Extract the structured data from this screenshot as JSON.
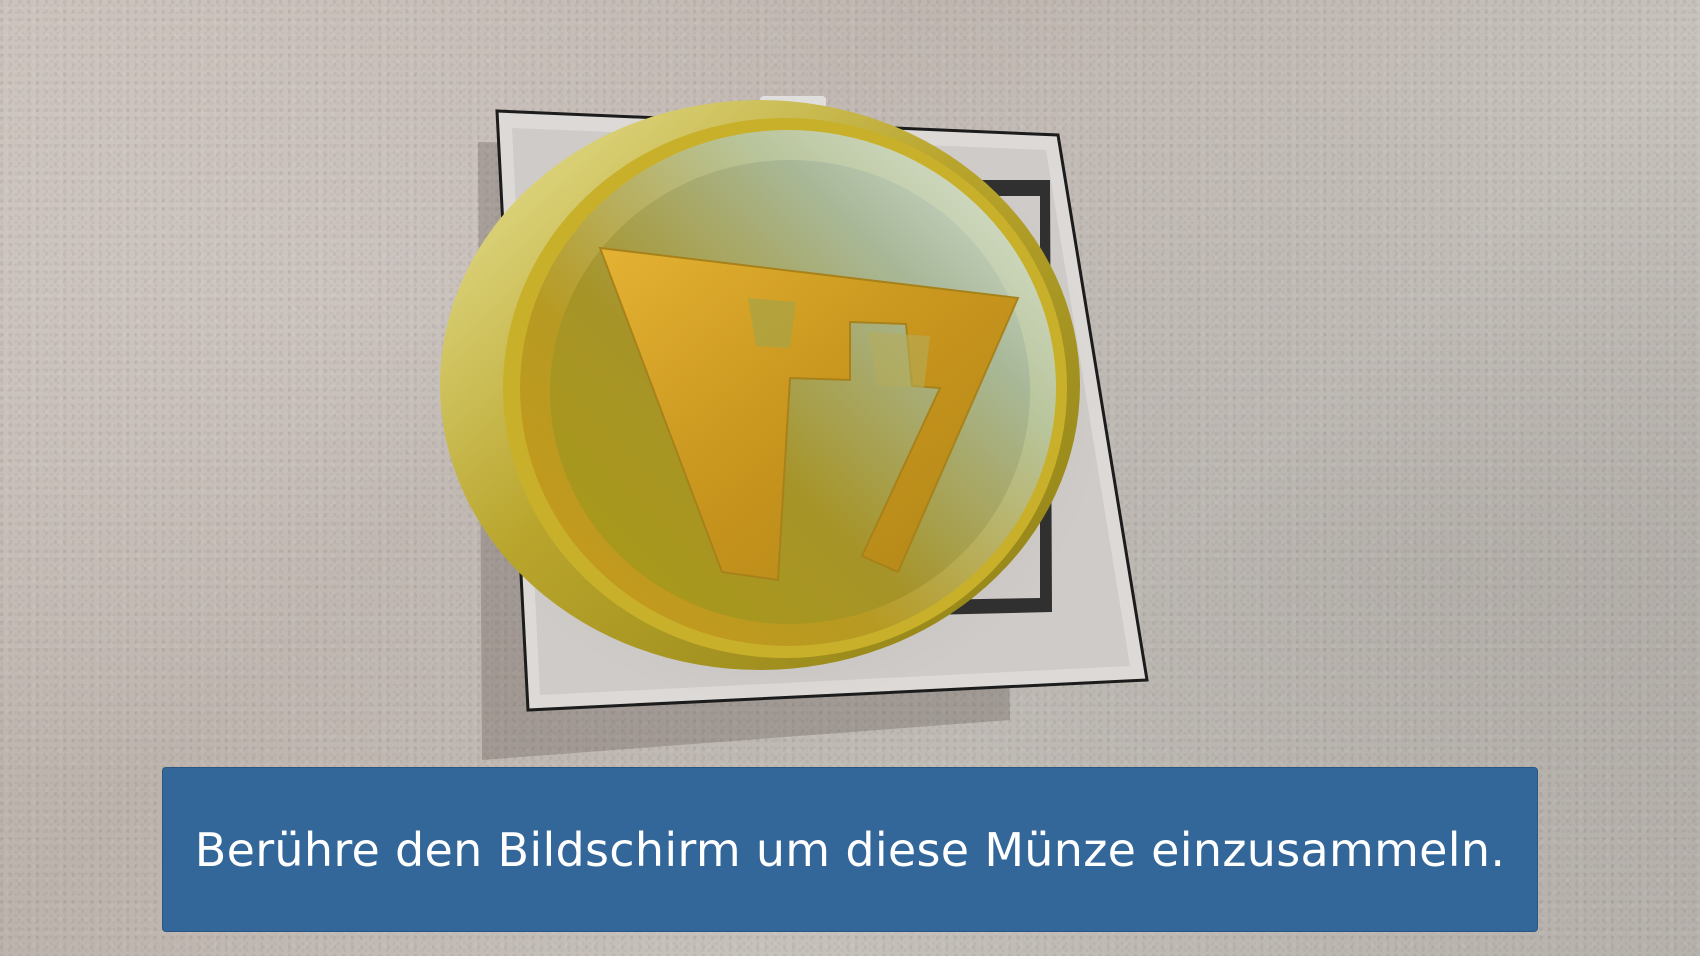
{
  "instruction": {
    "text": "Berühre den Bildschirm um diese Münze einzusammeln."
  },
  "scene": {
    "object": "collectible-coin",
    "coin_emblem": "w-logo",
    "marker": "printed-ar-marker-on-wall"
  },
  "colors": {
    "banner_background": "#336699",
    "banner_text": "#ffffff",
    "coin_gold": "#c9a52a",
    "wall": "#c4bcb6"
  }
}
